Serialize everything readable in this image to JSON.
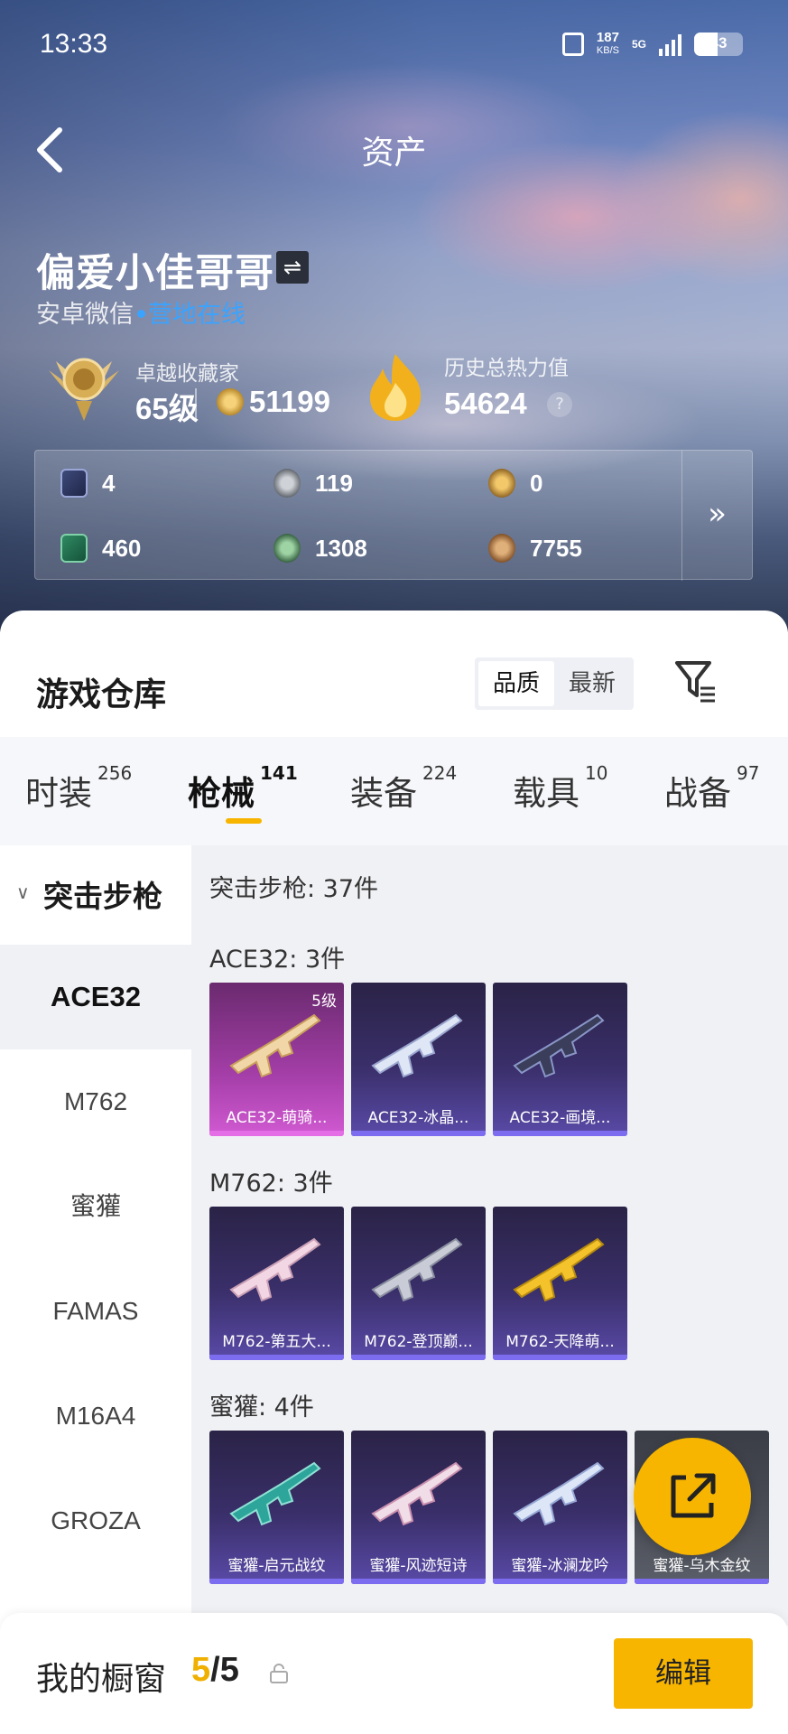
{
  "status_bar": {
    "time": "13:33",
    "speed_value": "187",
    "speed_unit": "KB/S",
    "network": "5G",
    "battery": "43"
  },
  "nav": {
    "title": "资产"
  },
  "user": {
    "name": "偏爱小佳哥哥",
    "platform": "安卓微信",
    "status": "营地在线"
  },
  "rank": {
    "label": "卓越收藏家",
    "level": "65级",
    "coins": "51199"
  },
  "heat": {
    "label": "历史总热力值",
    "value": "54624",
    "help": "?"
  },
  "currencies": [
    {
      "icon": "card-icon",
      "value": "4"
    },
    {
      "icon": "silver-coin-icon",
      "value": "119"
    },
    {
      "icon": "gold-token-icon",
      "value": "0"
    },
    {
      "icon": "ticket-icon",
      "value": "460"
    },
    {
      "icon": "green-coin-icon",
      "value": "1308"
    },
    {
      "icon": "bronze-coin-icon",
      "value": "7755"
    }
  ],
  "warehouse": {
    "title": "游戏仓库",
    "sort_options": [
      "品质",
      "最新"
    ],
    "sort_selected": "品质"
  },
  "tabs": [
    {
      "label": "时装",
      "count": "256"
    },
    {
      "label": "枪械",
      "count": "141"
    },
    {
      "label": "装备",
      "count": "224"
    },
    {
      "label": "载具",
      "count": "10"
    },
    {
      "label": "战备",
      "count": "97"
    }
  ],
  "sidebar": {
    "category": "突击步枪",
    "items": [
      "ACE32",
      "M762",
      "蜜獾",
      "FAMAS",
      "M16A4",
      "GROZA"
    ]
  },
  "content": {
    "category_summary": "突击步枪: 37件",
    "groups": [
      {
        "title": "ACE32: 3件",
        "items": [
          {
            "name": "ACE32-萌骑...",
            "level": "5级"
          },
          {
            "name": "ACE32-冰晶..."
          },
          {
            "name": "ACE32-画境..."
          }
        ]
      },
      {
        "title": "M762: 3件",
        "items": [
          {
            "name": "M762-第五大..."
          },
          {
            "name": "M762-登顶巅..."
          },
          {
            "name": "M762-天降萌..."
          }
        ]
      },
      {
        "title": "蜜獾: 4件",
        "items": [
          {
            "name": "蜜獾-启元战纹"
          },
          {
            "name": "蜜獾-风迹短诗"
          },
          {
            "name": "蜜獾-冰澜龙吟"
          },
          {
            "name": "蜜獾-乌木金纹"
          }
        ]
      }
    ]
  },
  "bottom": {
    "label": "我的橱窗",
    "count_current": "5",
    "count_sep": "/",
    "count_total": "5",
    "edit_label": "编辑"
  },
  "colors": {
    "accent": "#f7b500",
    "online": "#3aa3ff",
    "tile_purple": "#3a2f6a",
    "tile_pink": "#a43ea8"
  }
}
